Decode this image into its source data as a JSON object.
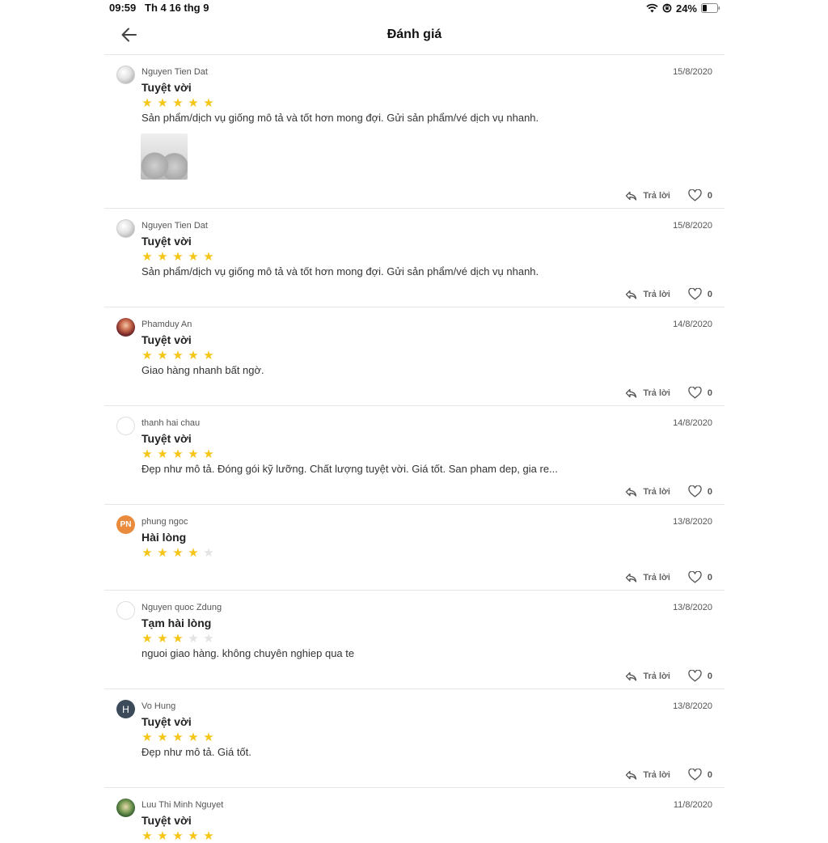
{
  "status": {
    "time": "09:59",
    "date": "Th 4 16 thg 9",
    "battery": "24%"
  },
  "header": {
    "title": "Đánh giá"
  },
  "actions": {
    "reply_label": "Trả lời"
  },
  "reviews": [
    {
      "name": "Nguyen Tien Dat",
      "date": "15/8/2020",
      "rating_label": "Tuyệt vời",
      "stars": 5,
      "text": "Sản phẩm/dịch vụ giống mô tả và tốt hơn mong đợi. Gửi sản phẩm/vé dịch vụ nhanh.",
      "likes": "0"
    },
    {
      "name": "Nguyen Tien Dat",
      "date": "15/8/2020",
      "rating_label": "Tuyệt vời",
      "stars": 5,
      "text": "Sản phẩm/dịch vụ giống mô tả và tốt hơn mong đợi. Gửi sản phẩm/vé dịch vụ nhanh.",
      "likes": "0"
    },
    {
      "name": "Phamduy An",
      "date": "14/8/2020",
      "rating_label": "Tuyệt vời",
      "stars": 5,
      "text": "Giao hàng nhanh bất ngờ.",
      "likes": "0"
    },
    {
      "name": "thanh hai chau",
      "date": "14/8/2020",
      "rating_label": "Tuyệt vời",
      "stars": 5,
      "text": "Đẹp như mô tả. Đóng gói kỹ lưỡng. Chất lượng tuyệt vời. Giá tốt. San pham dep, gia re...",
      "likes": "0"
    },
    {
      "name": "phung ngoc",
      "initials": "PN",
      "date": "13/8/2020",
      "rating_label": "Hài lòng",
      "stars": 4,
      "likes": "0"
    },
    {
      "name": "Nguyen quoc Zdung",
      "date": "13/8/2020",
      "rating_label": "Tạm hài lòng",
      "stars": 3,
      "text": "nguoi giao hàng. không chuyên nghiep qua te",
      "likes": "0"
    },
    {
      "name": "Vo Hung",
      "initials": "H",
      "date": "13/8/2020",
      "rating_label": "Tuyệt vời",
      "stars": 5,
      "text": "Đẹp như mô tả. Giá tốt.",
      "likes": "0"
    },
    {
      "name": "Luu Thi Minh Nguyet",
      "date": "11/8/2020",
      "rating_label": "Tuyệt vời",
      "stars": 5
    }
  ],
  "colors": {
    "star_on": "#f5c518",
    "star_off": "#e3e3e3",
    "avatar_pn": "#ea8a3c",
    "avatar_h": "#3c4a5a"
  },
  "icons": [
    "back-arrow-icon",
    "wifi-icon",
    "orientation-lock-icon",
    "battery-icon",
    "star-icon",
    "reply-icon",
    "heart-icon"
  ]
}
